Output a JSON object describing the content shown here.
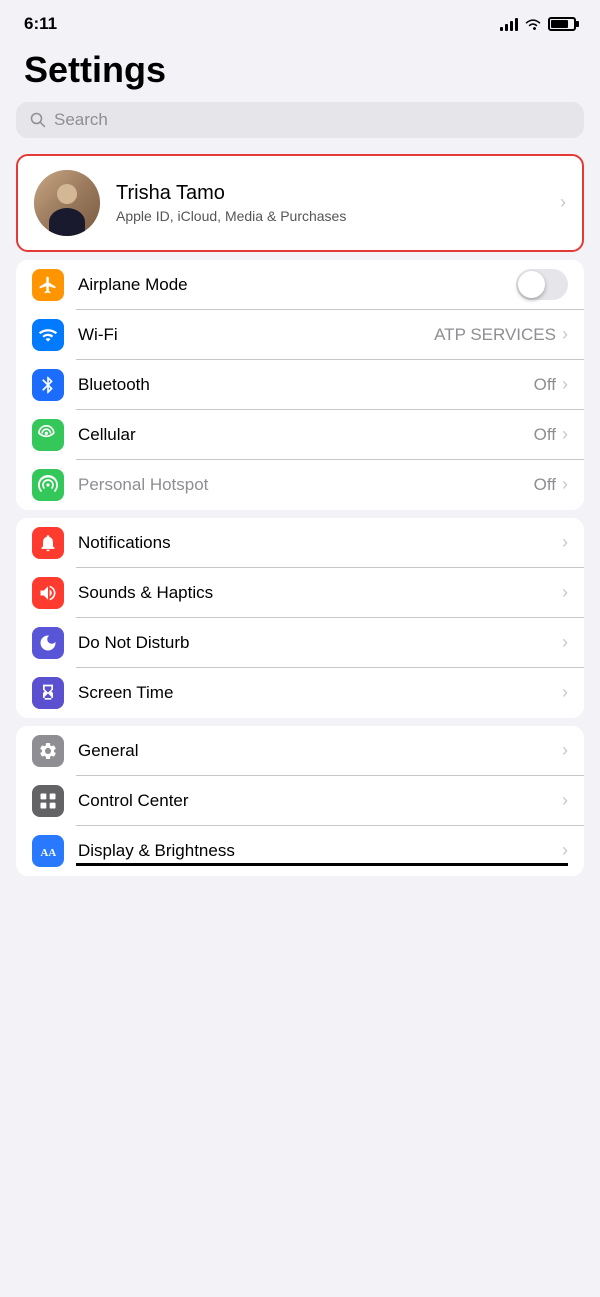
{
  "statusBar": {
    "time": "6:11"
  },
  "header": {
    "title": "Settings"
  },
  "search": {
    "placeholder": "Search"
  },
  "profile": {
    "name": "Trisha Tamo",
    "subtitle": "Apple ID, iCloud, Media & Purchases"
  },
  "sections": [
    {
      "id": "connectivity",
      "rows": [
        {
          "id": "airplane-mode",
          "label": "Airplane Mode",
          "icon": "airplane",
          "iconBg": "bg-orange",
          "control": "toggle",
          "value": ""
        },
        {
          "id": "wifi",
          "label": "Wi-Fi",
          "icon": "wifi",
          "iconBg": "bg-blue",
          "value": "ATP SERVICES"
        },
        {
          "id": "bluetooth",
          "label": "Bluetooth",
          "icon": "bluetooth",
          "iconBg": "bg-blue-dark",
          "value": "Off"
        },
        {
          "id": "cellular",
          "label": "Cellular",
          "icon": "cellular",
          "iconBg": "bg-green",
          "value": "Off"
        },
        {
          "id": "personal-hotspot",
          "label": "Personal Hotspot",
          "icon": "hotspot",
          "iconBg": "bg-green-light",
          "value": "Off",
          "dimmed": true
        }
      ]
    },
    {
      "id": "notifications-group",
      "rows": [
        {
          "id": "notifications",
          "label": "Notifications",
          "icon": "notifications",
          "iconBg": "bg-red-notif"
        },
        {
          "id": "sounds-haptics",
          "label": "Sounds & Haptics",
          "icon": "sounds",
          "iconBg": "bg-red-sounds"
        },
        {
          "id": "do-not-disturb",
          "label": "Do Not Disturb",
          "icon": "moon",
          "iconBg": "bg-purple"
        },
        {
          "id": "screen-time",
          "label": "Screen Time",
          "icon": "hourglass",
          "iconBg": "bg-indigo"
        }
      ]
    },
    {
      "id": "system-group",
      "rows": [
        {
          "id": "general",
          "label": "General",
          "icon": "gear",
          "iconBg": "bg-gray"
        },
        {
          "id": "control-center",
          "label": "Control Center",
          "icon": "toggles",
          "iconBg": "bg-gray-mid"
        },
        {
          "id": "display-brightness",
          "label": "Display & Brightness",
          "icon": "aa",
          "iconBg": "bg-blue-aa"
        }
      ]
    }
  ]
}
